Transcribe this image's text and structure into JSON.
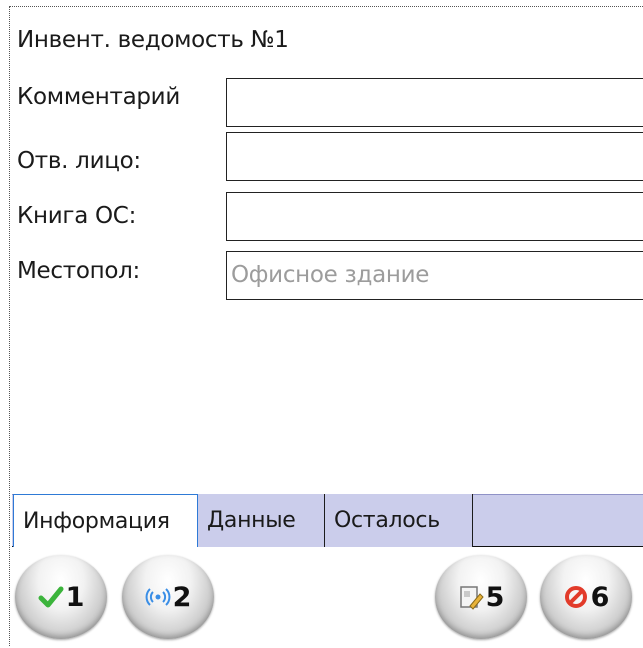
{
  "form": {
    "title": "Инвент. ведомость №1",
    "fields": [
      {
        "label": "Комментарий",
        "value": ""
      },
      {
        "label": "Отв. лицо:",
        "value": ""
      },
      {
        "label": "Книга ОС:",
        "value": ""
      },
      {
        "label": "Местопол:",
        "value": "Офисное здание"
      }
    ]
  },
  "tabs": [
    {
      "label": "Информация",
      "active": true
    },
    {
      "label": "Данные",
      "active": false
    },
    {
      "label": "Осталось",
      "active": false
    }
  ],
  "buttons": [
    {
      "number": "1",
      "icon": "check-icon"
    },
    {
      "number": "2",
      "icon": "wireless-icon"
    },
    {
      "number": "5",
      "icon": "edit-document-icon"
    },
    {
      "number": "6",
      "icon": "cancel-icon"
    }
  ]
}
